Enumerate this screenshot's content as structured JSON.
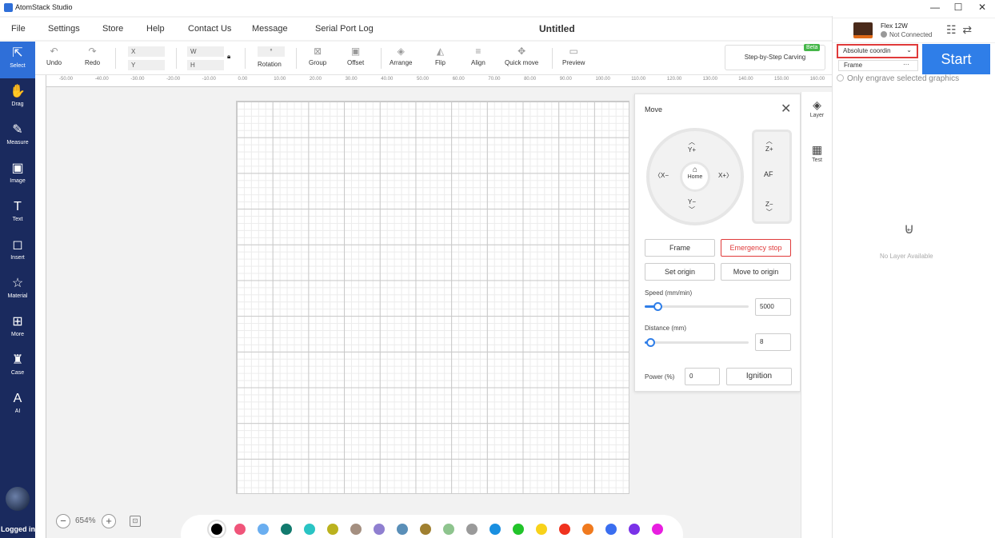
{
  "window": {
    "app_title": "AtomStack Studio",
    "minimize": "—",
    "maximize": "☐",
    "close": "✕"
  },
  "menu": {
    "items": [
      "File",
      "Settings",
      "Store",
      "Help",
      "Contact Us",
      "Message",
      "Serial Port Log"
    ],
    "document_title": "Untitled"
  },
  "sidebar": {
    "items": [
      {
        "label": "Select",
        "icon": "cursor-icon",
        "glyph": "⇱"
      },
      {
        "label": "Drag",
        "icon": "hand-icon",
        "glyph": "✋"
      },
      {
        "label": "Measure",
        "icon": "ruler-icon",
        "glyph": "✎"
      },
      {
        "label": "Image",
        "icon": "image-icon",
        "glyph": "▣"
      },
      {
        "label": "Text",
        "icon": "text-icon",
        "glyph": "T"
      },
      {
        "label": "Insert",
        "icon": "shape-insert-icon",
        "glyph": "◻"
      },
      {
        "label": "Material",
        "icon": "star-icon",
        "glyph": "☆"
      },
      {
        "label": "More",
        "icon": "grid-more-icon",
        "glyph": "⊞"
      },
      {
        "label": "Case",
        "icon": "gift-icon",
        "glyph": "♜"
      },
      {
        "label": "AI",
        "icon": "ai-icon",
        "glyph": "A"
      }
    ],
    "active_index": 0,
    "logged_in_label": "Logged in"
  },
  "toolbar": {
    "undo": "Undo",
    "redo": "Redo",
    "x_label": "X",
    "y_label": "Y",
    "w_label": "W",
    "h_label": "H",
    "rotation_value": "°",
    "rotation": "Rotation",
    "group": "Group",
    "offset": "Offset",
    "arrange": "Arrange",
    "flip": "Flip",
    "align": "Align",
    "quick_move": "Quick move",
    "preview": "Preview",
    "step_by_step": "Step-by-Step Carving",
    "beta": "Beta"
  },
  "device": {
    "name": "Flex 12W",
    "status": "Not Connected",
    "coordinate_mode": "Absolute coordin",
    "frame_mode": "Frame",
    "frame_more": "···",
    "start": "Start",
    "only_engrave": "Only engrave selected graphics"
  },
  "layer_tabs": {
    "layer": "Layer",
    "test": "Test"
  },
  "no_layer": "No Layer Available",
  "ruler_ticks": [
    "-50.00",
    "-40.00",
    "-30.00",
    "-20.00",
    "-10.00",
    "0.00",
    "10.00",
    "20.00",
    "30.00",
    "40.00",
    "50.00",
    "60.00",
    "70.00",
    "80.00",
    "90.00",
    "100.00",
    "110.00",
    "120.00",
    "130.00",
    "140.00",
    "150.00",
    "160.00"
  ],
  "move_panel": {
    "title": "Move",
    "y_plus": "Y+",
    "y_minus": "Y−",
    "x_minus": "X−",
    "x_plus": "X+",
    "home": "Home",
    "z_plus": "Z+",
    "af": "AF",
    "z_minus": "Z−",
    "frame": "Frame",
    "emergency_stop": "Emergency stop",
    "set_origin": "Set origin",
    "move_to_origin": "Move to origin",
    "speed_label": "Speed (mm/min)",
    "speed_value": "5000",
    "speed_fraction": 0.12,
    "distance_label": "Distance (mm)",
    "distance_value": "8",
    "distance_fraction": 0.05,
    "power_label": "Power (%)",
    "power_value": "0",
    "ignition": "Ignition"
  },
  "zoom": {
    "value": "654%",
    "minus": "−",
    "plus": "+",
    "fit": "⊡"
  },
  "palette": [
    "#000000",
    "#f0557a",
    "#6aaef0",
    "#127a6e",
    "#2ac4c4",
    "#bbb21e",
    "#a48f80",
    "#8f7fd0",
    "#5a8fb8",
    "#a08030",
    "#8ec48e",
    "#9a9a9a",
    "#1a8fe0",
    "#22c42a",
    "#f8d21a",
    "#f0321e",
    "#f07a1e",
    "#3a6ef0",
    "#7a32e8",
    "#e81ee0"
  ]
}
